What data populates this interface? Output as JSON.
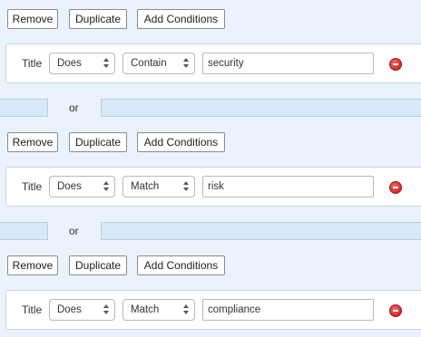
{
  "toolbar": {
    "remove_label": "Remove",
    "duplicate_label": "Duplicate",
    "add_conditions_label": "Add Conditions"
  },
  "or_label": "or",
  "conditions": [
    {
      "field": "Title",
      "negation": "Does",
      "operator": "Contain",
      "value": "security"
    },
    {
      "field": "Title",
      "negation": "Does",
      "operator": "Match",
      "value": "risk"
    },
    {
      "field": "Title",
      "negation": "Does",
      "operator": "Match",
      "value": "compliance"
    }
  ],
  "icons": {
    "remove_condition": "minus-circle-icon",
    "select_arrows": "updown-arrows-icon"
  },
  "colors": {
    "background": "#eaf3fc",
    "separator": "#d7e9f8",
    "remove_icon": "#d62a2a"
  }
}
